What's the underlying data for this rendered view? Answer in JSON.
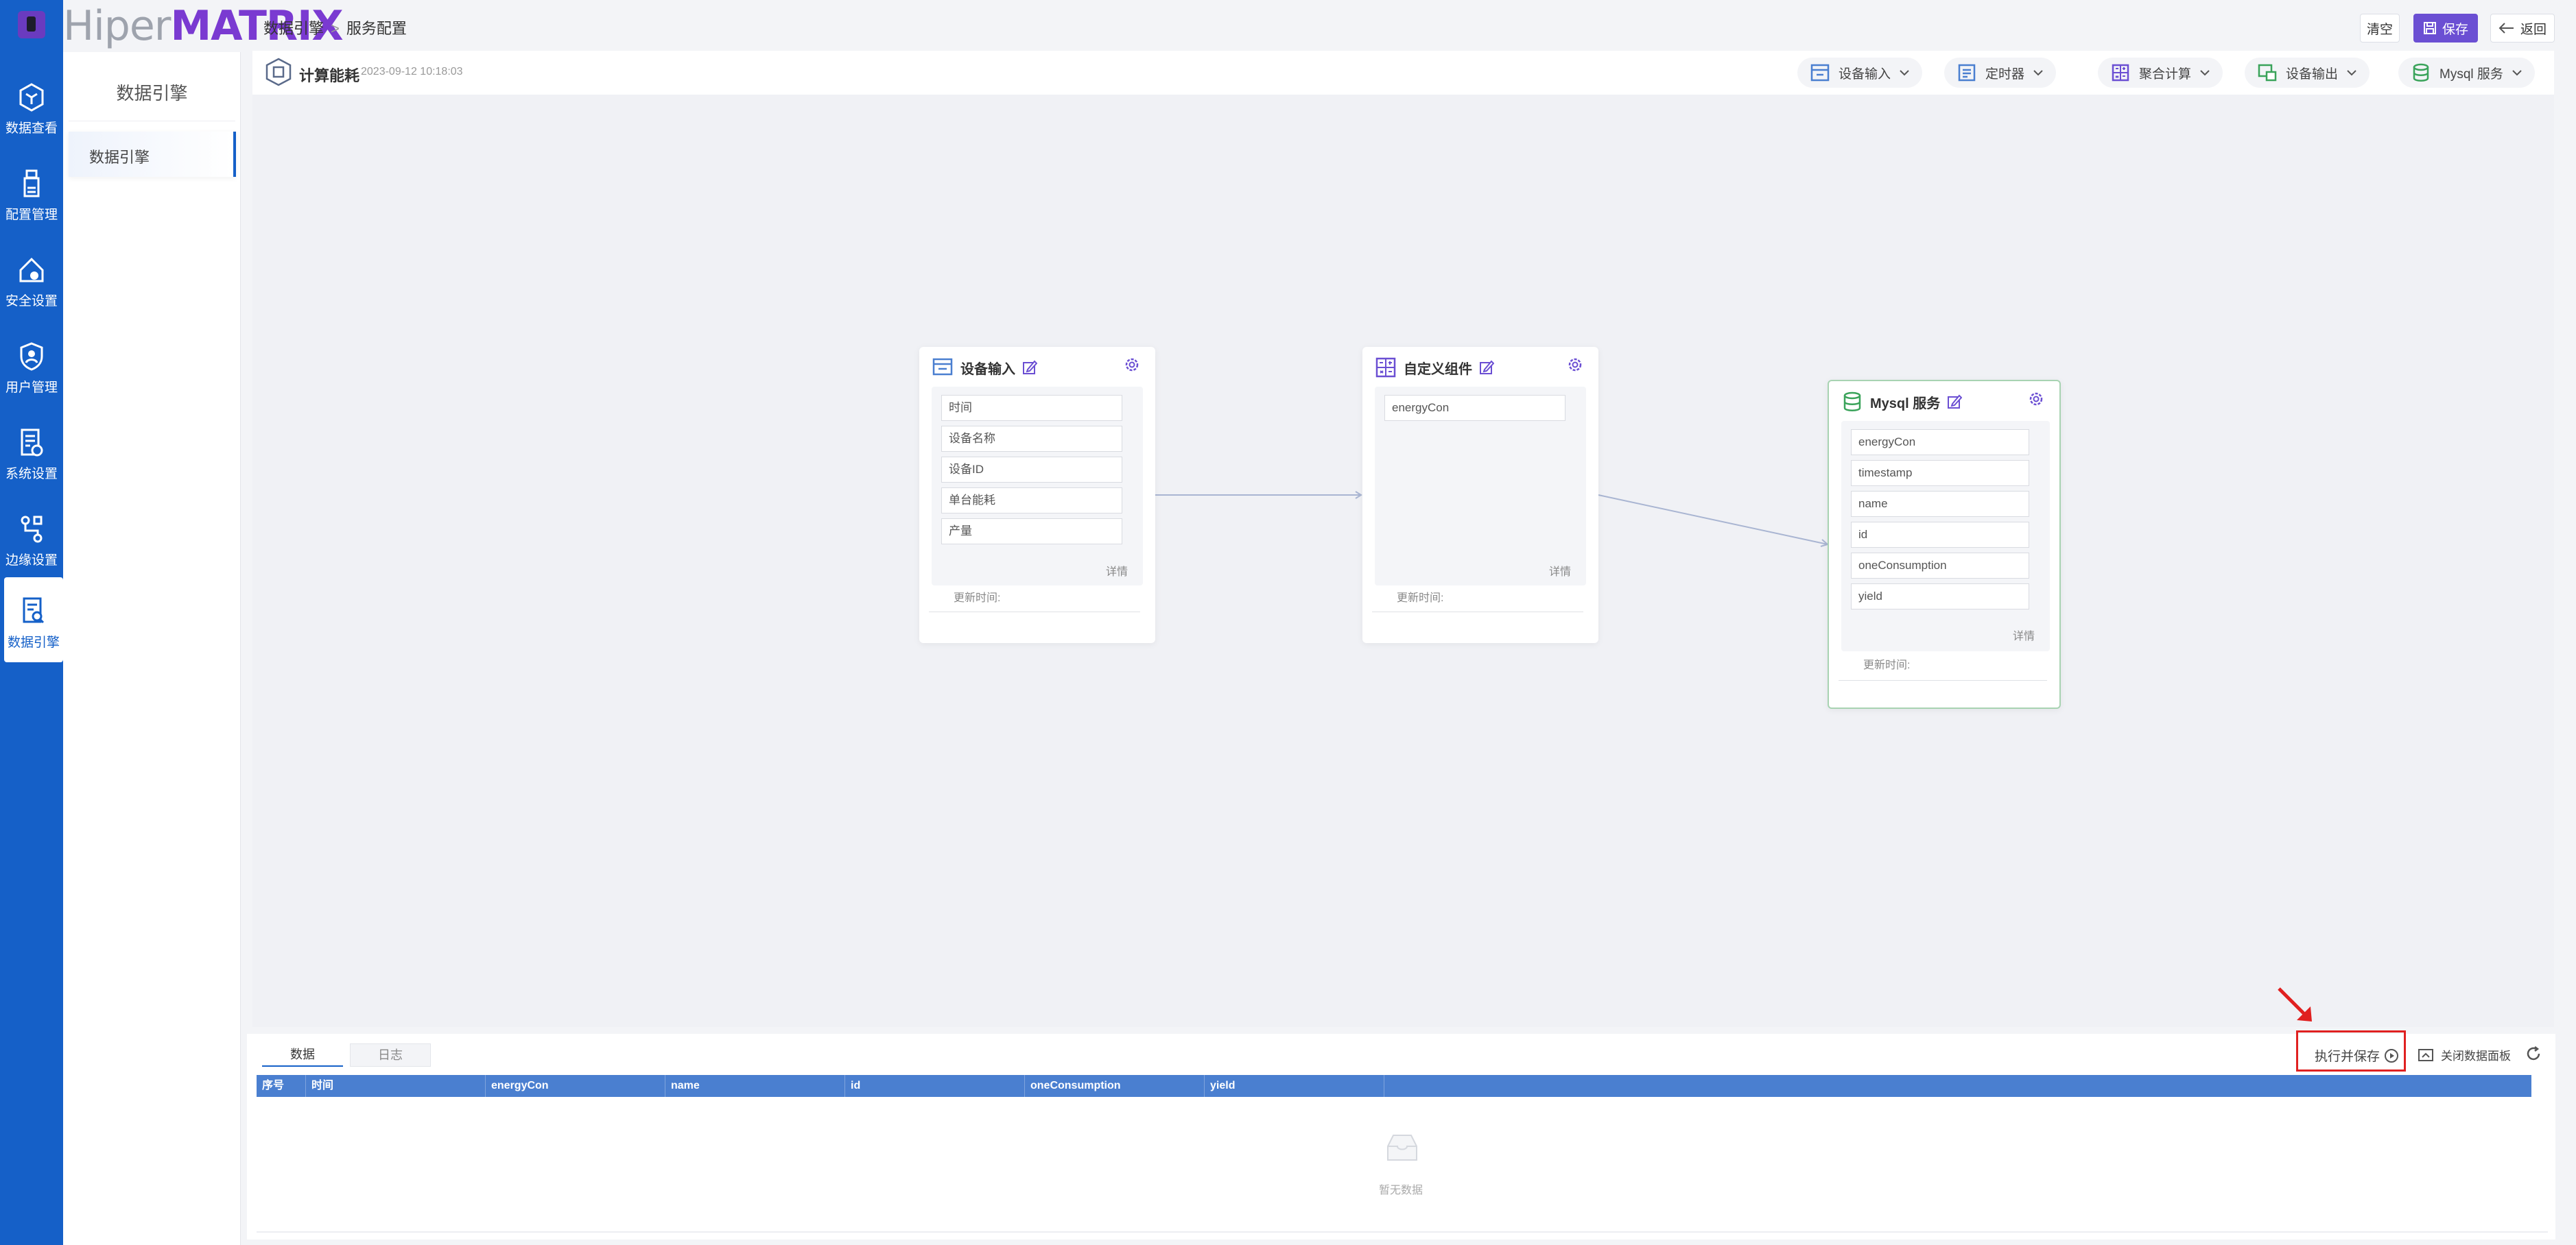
{
  "brand": {
    "part1": "Hiper",
    "part2": "MATRIX"
  },
  "rail": {
    "items": [
      {
        "label": "数据查看",
        "icon": "hexagon-box-icon"
      },
      {
        "label": "配置管理",
        "icon": "flask-config-icon"
      },
      {
        "label": "安全设置",
        "icon": "home-shield-icon"
      },
      {
        "label": "用户管理",
        "icon": "user-shield-icon"
      },
      {
        "label": "系统设置",
        "icon": "document-settings-icon"
      },
      {
        "label": "边缘设置",
        "icon": "workflow-icon"
      },
      {
        "label": "数据引擎",
        "icon": "document-search-icon",
        "active": true
      }
    ]
  },
  "subside": {
    "title": "数据引擎",
    "item": "数据引擎"
  },
  "breadcrumb": {
    "root": "数据引擎",
    "sep": ">",
    "current": "服务配置"
  },
  "topbar": {
    "clear": "清空",
    "save": "保存",
    "back": "返回"
  },
  "header": {
    "title": "计算能耗",
    "date": "2023-09-12 10:18:03"
  },
  "toolbar": [
    {
      "label": "设备输入",
      "icon": "device-input-icon"
    },
    {
      "label": "定时器",
      "icon": "timer-icon"
    },
    {
      "label": "聚合计算",
      "icon": "calculator-icon"
    },
    {
      "label": "设备输出",
      "icon": "device-output-icon"
    },
    {
      "label": "Mysql 服务",
      "icon": "database-icon"
    }
  ],
  "nodes": {
    "device_input": {
      "title": "设备输入",
      "fields": [
        "时间",
        "设备名称",
        "设备ID",
        "单台能耗",
        "产量"
      ],
      "detail": "详情",
      "updated": "更新时间:"
    },
    "custom": {
      "title": "自定义组件",
      "fields": [
        "energyCon"
      ],
      "detail": "详情",
      "updated": "更新时间:"
    },
    "mysql": {
      "title": "Mysql 服务",
      "fields": [
        "energyCon",
        "timestamp",
        "name",
        "id",
        "oneConsumption",
        "yield"
      ],
      "detail": "详情",
      "updated": "更新时间:"
    }
  },
  "panel": {
    "tabs": [
      "数据",
      "日志"
    ],
    "run": "执行并保存",
    "close": "关闭数据面板",
    "columns": [
      "序号",
      "时间",
      "energyCon",
      "name",
      "id",
      "oneConsumption",
      "yield"
    ],
    "empty": "暂无数据"
  },
  "colors": {
    "rail": "#1560c8",
    "primary": "#6b4fd3",
    "table_header": "#4a7fd0",
    "highlight": "#e02020"
  }
}
